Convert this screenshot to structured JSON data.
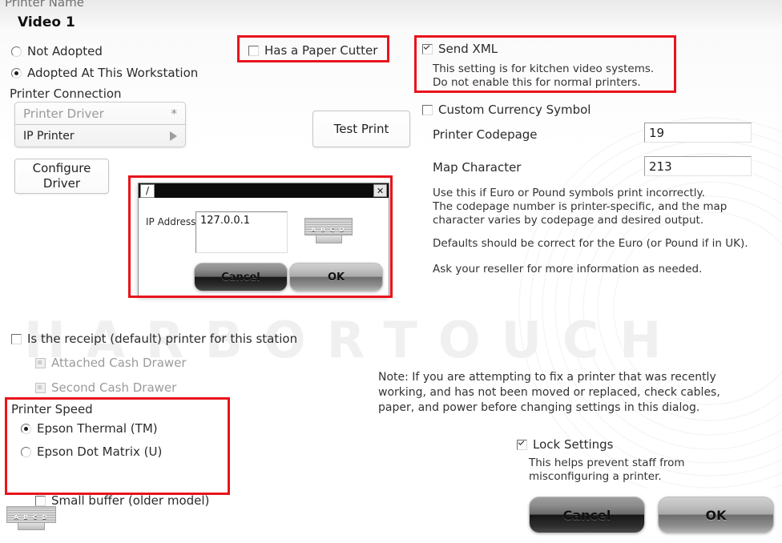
{
  "window": {
    "printer_name_label": "Printer Name",
    "printer_name_value": "Video 1"
  },
  "adoption": {
    "not_adopted_label": "Not Adopted",
    "adopted_label": "Adopted At This Workstation"
  },
  "connection": {
    "section_label": "Printer Connection",
    "driver_placeholder": "Printer Driver",
    "driver_star": "*",
    "selected_driver": "IP Printer",
    "configure_button": "Configure\nDriver"
  },
  "test_print": {
    "label": "Test Print"
  },
  "options": {
    "paper_cutter_label": "Has a Paper Cutter",
    "paper_cutter_checked": false,
    "send_xml_label": "Send XML",
    "send_xml_checked": true,
    "send_xml_help": "This setting is for kitchen video systems.\nDo not enable this for normal printers.",
    "custom_currency_label": "Custom Currency Symbol",
    "custom_currency_checked": false
  },
  "codepage": {
    "codepage_label": "Printer Codepage",
    "codepage_value": "19",
    "map_character_label": "Map Character",
    "map_character_value": "213",
    "help_1": "Use this if Euro or Pound symbols print incorrectly.\nThe codepage number is printer-specific, and the map\ncharacter varies by codepage and desired output.",
    "help_2": "Defaults should be correct for the Euro (or Pound if in UK).",
    "help_3": "Ask your reseller for more information as needed."
  },
  "receipt": {
    "default_printer_label": "Is the receipt (default) printer for this station",
    "default_printer_checked": false,
    "attached_cash_drawer_label": "Attached Cash Drawer",
    "second_cash_drawer_label": "Second Cash Drawer"
  },
  "speed": {
    "section_label": "Printer Speed",
    "thermal_label": "Epson Thermal (TM)",
    "thermal_selected": true,
    "dot_matrix_label": "Epson Dot Matrix (U)",
    "dot_matrix_selected": false,
    "small_buffer_label": "Small buffer (older model)",
    "small_buffer_checked": false
  },
  "note": {
    "text": "Note: If you are attempting to fix a printer that was recently\nworking, and has not been moved or replaced, check cables,\npaper, and power before changing settings in this dialog."
  },
  "lock": {
    "label": "Lock Settings",
    "checked": true,
    "help": "This helps prevent staff from\nmisconfiguring a printer."
  },
  "footer": {
    "cancel_label": "Cancel",
    "ok_label": "OK"
  },
  "ip_dialog": {
    "title_icon": "/",
    "close_label": "✕",
    "ip_label": "IP Address",
    "ip_value": "127.0.0.1",
    "cancel_label": "Cancel",
    "ok_label": "OK",
    "printer_icon_label": "A B C D"
  },
  "branding": {
    "watermark": "HARBORTOUCH",
    "printer_icon_label": "A B C D"
  },
  "annotations": {
    "highlight_color": "#e8141b"
  }
}
